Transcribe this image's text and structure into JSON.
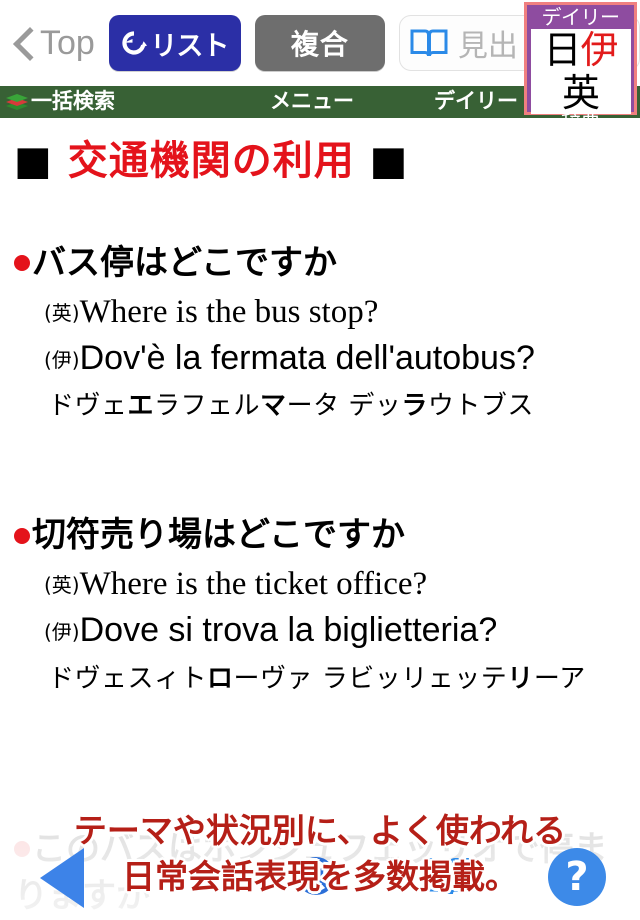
{
  "toolbar": {
    "back_label": "Top",
    "back_icon": "chevron-left-icon",
    "list_button_label": "リスト",
    "list_button_icon": "refresh-arrow-icon",
    "compound_button_label": "複合",
    "search_icon": "open-book-icon",
    "search_placeholder": "見出し",
    "search_value": "",
    "colors": {
      "list_button": "#2b2fa6",
      "compound_button": "#6e6e6e",
      "back_text": "#9a9a9a"
    }
  },
  "navbar": {
    "bg_color": "#386135",
    "left_icon": "stacked-books-icon",
    "left_label": "一括検索",
    "center_label": "メニュー",
    "right_label": "デイリー"
  },
  "dictionary_badge": {
    "top_label": "デイリー",
    "middle": {
      "ja": "日",
      "it": "伊",
      "en": "英"
    },
    "bottom_label": "辞典",
    "bg_color": "#8e4ca0",
    "border_color": "#f08080",
    "accent_color": "#e21b1b"
  },
  "content": {
    "section_heading": {
      "left_square": "■",
      "text": "交通機関の利用",
      "right_square": "■",
      "text_color": "#e4131b"
    },
    "entries": [
      {
        "bullet": "●",
        "japanese": "バス停はどこですか",
        "english_tag": "(英)",
        "english": "Where is the bus stop?",
        "italian_tag": "(伊)",
        "italian": "Dov'è la fermata dell'autobus?",
        "kana": [
          {
            "t": "ドヴェ",
            "b": false
          },
          {
            "t": "エ",
            "b": true
          },
          {
            "t": "ラフェル",
            "b": false
          },
          {
            "t": "マ",
            "b": true
          },
          {
            "t": "ータ デッ",
            "b": false
          },
          {
            "t": "ラ",
            "b": true
          },
          {
            "t": "ウトブス",
            "b": false
          }
        ]
      },
      {
        "bullet": "●",
        "japanese": "切符売り場はどこですか",
        "english_tag": "(英)",
        "english": "Where is the ticket office?",
        "italian_tag": "(伊)",
        "italian": "Dove si trova la biglietteria?",
        "kana": [
          {
            "t": "ドヴェスィト",
            "b": false
          },
          {
            "t": "ロ",
            "b": true
          },
          {
            "t": "ーヴァ ラビッリェッテ",
            "b": false
          },
          {
            "t": "リ",
            "b": true
          },
          {
            "t": "ーア",
            "b": false
          }
        ]
      }
    ],
    "faded_entry": {
      "bullet": "●",
      "japanese": "このバスはホンジュフェッリオで停ま",
      "second_line": "りますか"
    }
  },
  "promo": {
    "line1": "テーマや状況別に、よく使われる",
    "line2": "日常会話表現を多数掲載。",
    "text_color": "#b51f17"
  },
  "bottom_bar": {
    "back_icon": "back-triangle-icon",
    "gear_icon": "gear-icon",
    "book_icon": "open-book-icon",
    "help_label": "?",
    "help_icon": "help-circle-icon",
    "accent_color": "#3d8ae8"
  }
}
